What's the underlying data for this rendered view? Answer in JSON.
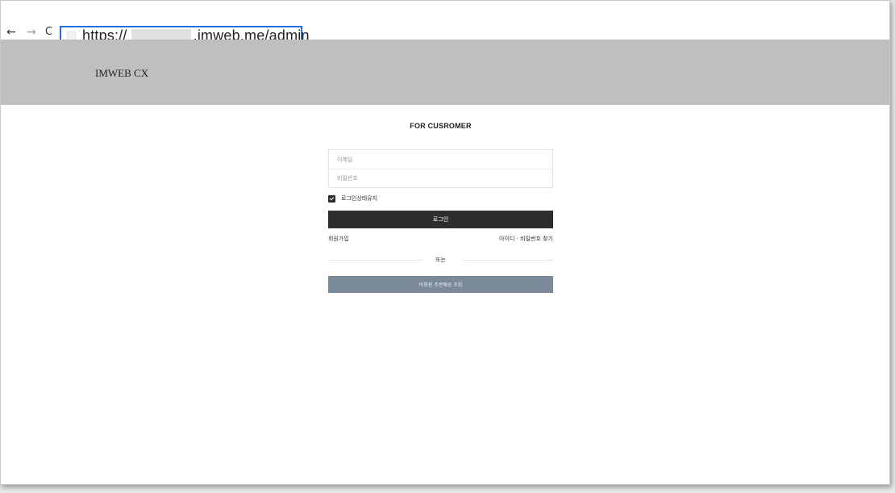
{
  "browser": {
    "back_icon": "←",
    "forward_icon": "→",
    "reload_icon": "C",
    "url_prefix": "https://",
    "url_suffix": ".imweb.me/admin",
    "highlight_color": "#1f6fe6"
  },
  "header": {
    "logo": "IMWEB CX",
    "background": "#bfbfbf"
  },
  "login": {
    "title": "FOR CUSROMER",
    "email_placeholder": "이메일",
    "password_placeholder": "비밀번호",
    "keep_logged_in": "로그인상태유지",
    "keep_checked": true,
    "login_button": "로그인",
    "signup_link": "회원가입",
    "find_link": "아이디 · 비밀번호 찾기",
    "divider_text": "또는",
    "guest_button": "비회원 주문배송 조회"
  },
  "colors": {
    "login_button": "#2e2e2e",
    "guest_button": "#7a8a9b"
  }
}
